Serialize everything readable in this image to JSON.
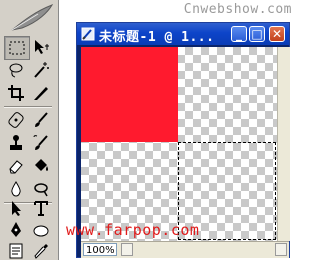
{
  "watermark": "Cnwebshow.com",
  "site_watermark": "www.farpop.com",
  "window": {
    "title": "未标题-1 @ 1...",
    "minimize_label": "_",
    "maximize_label": "□",
    "close_label": "✕",
    "zoom": "100%"
  },
  "canvas": {
    "fill_color": "#ff1a2e",
    "selection": "marquee"
  },
  "tools": [
    {
      "name": "rectangular-marquee-tool",
      "selected": true
    },
    {
      "name": "move-tool"
    },
    {
      "name": "lasso-tool"
    },
    {
      "name": "magic-wand-tool"
    },
    {
      "name": "crop-tool"
    },
    {
      "name": "slice-tool"
    },
    {
      "name": "healing-brush-tool"
    },
    {
      "name": "brush-tool"
    },
    {
      "name": "clone-stamp-tool"
    },
    {
      "name": "history-brush-tool"
    },
    {
      "name": "eraser-tool"
    },
    {
      "name": "paint-bucket-tool"
    },
    {
      "name": "blur-tool"
    },
    {
      "name": "dodge-tool"
    },
    {
      "name": "path-selection-tool"
    },
    {
      "name": "type-tool"
    },
    {
      "name": "pen-tool"
    },
    {
      "name": "shape-tool"
    },
    {
      "name": "notes-tool"
    },
    {
      "name": "eyedropper-tool"
    }
  ]
}
